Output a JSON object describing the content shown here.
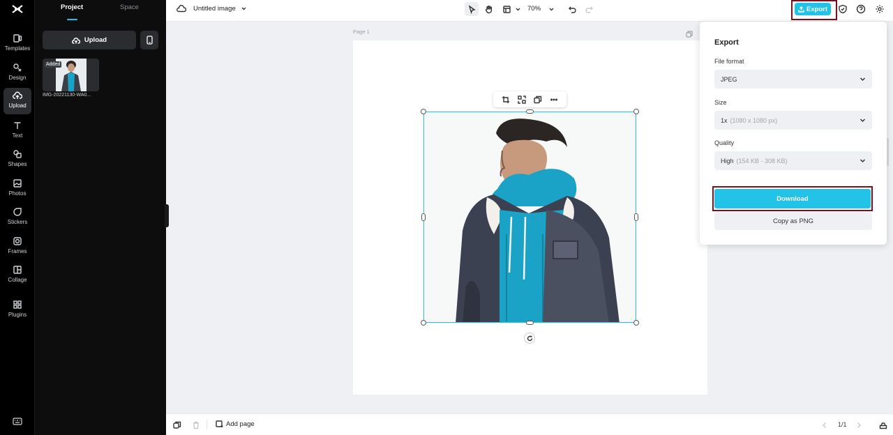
{
  "rail": {
    "items": [
      {
        "label": "Templates",
        "icon": "templates-icon"
      },
      {
        "label": "Design",
        "icon": "design-icon"
      },
      {
        "label": "Upload",
        "icon": "upload-cloud-icon"
      },
      {
        "label": "Text",
        "icon": "text-icon"
      },
      {
        "label": "Shapes",
        "icon": "shapes-icon"
      },
      {
        "label": "Photos",
        "icon": "photos-icon"
      },
      {
        "label": "Stickers",
        "icon": "stickers-icon"
      },
      {
        "label": "Frames",
        "icon": "frames-icon"
      },
      {
        "label": "Collage",
        "icon": "collage-icon"
      },
      {
        "label": "Plugins",
        "icon": "plugins-icon"
      }
    ],
    "active": "Upload"
  },
  "panel": {
    "tabs": [
      "Project",
      "Space"
    ],
    "upload_label": "Upload",
    "thumb_badge": "Added",
    "thumb_name": "IMG-20221130-WA0..."
  },
  "topbar": {
    "doc_title": "Untitled image",
    "zoom": "70%",
    "export_label": "Export"
  },
  "canvas": {
    "page_label": "Page 1"
  },
  "export_panel": {
    "title": "Export",
    "file_format_label": "File format",
    "file_format_value": "JPEG",
    "size_label": "Size",
    "size_value": "1x",
    "size_detail": "(1080 x 1080 px)",
    "quality_label": "Quality",
    "quality_value": "High",
    "quality_detail": "(154 KB - 308 KB)",
    "download_label": "Download",
    "copy_label": "Copy as PNG"
  },
  "bottombar": {
    "add_page_label": "Add page",
    "pager": "1/1"
  },
  "colors": {
    "accent": "#22c3e6",
    "highlight": "#7b0f1f",
    "rail_bg": "#000000",
    "canvas_bg": "#eef0f3"
  }
}
